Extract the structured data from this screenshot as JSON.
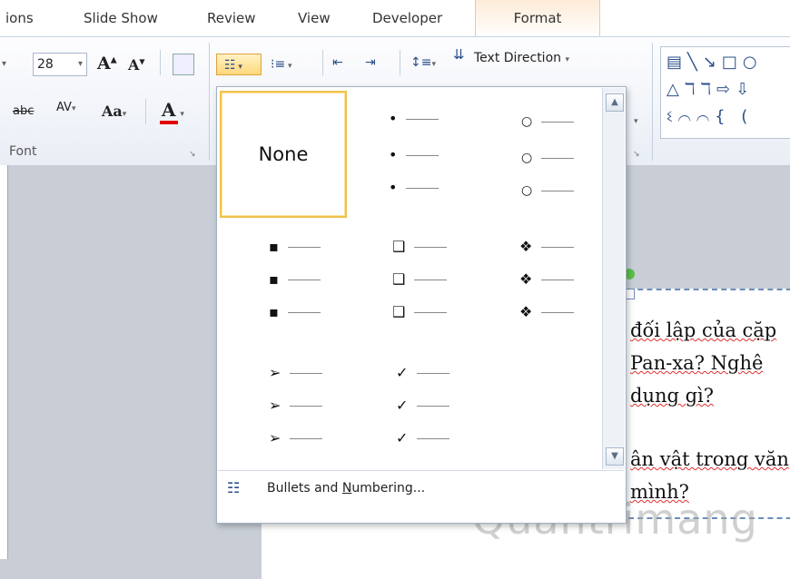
{
  "tabs": [
    {
      "label": "ions"
    },
    {
      "label": "Slide Show"
    },
    {
      "label": "Review"
    },
    {
      "label": "View"
    },
    {
      "label": "Developer"
    },
    {
      "label": "Format"
    }
  ],
  "ribbon": {
    "font_size": "28",
    "grow_font": "A",
    "shrink_font": "A",
    "strikethrough": "abc",
    "char_spacing": "AV",
    "change_case": "Aa",
    "font_color": "A",
    "font_group_label": "Font",
    "text_direction": "Text Direction",
    "text_direction_arrow": "▾",
    "bullets_icon": "☷",
    "numbering_icon": "⁝≡"
  },
  "gallery": {
    "none_label": "None",
    "bullet_styles": [
      "•",
      "○",
      "▪",
      "❑",
      "❖",
      "➢",
      "✓"
    ],
    "footer_label_prefix": "Bullets and ",
    "footer_label_underlined": "N",
    "footer_label_suffix": "umbering...",
    "scroll_up": "▲",
    "scroll_down": "▼"
  },
  "slide": {
    "lines": [
      "đối lập của cặp",
      "Pan-xa?  Nghê",
      "dụng gì?",
      "ân vật trong văn",
      "mình?"
    ]
  },
  "watermark": "Quantrimang",
  "colors": {
    "font_color_underline": "#e00000",
    "selection_border": "#f0c24b",
    "accent": "#fdebd6"
  }
}
